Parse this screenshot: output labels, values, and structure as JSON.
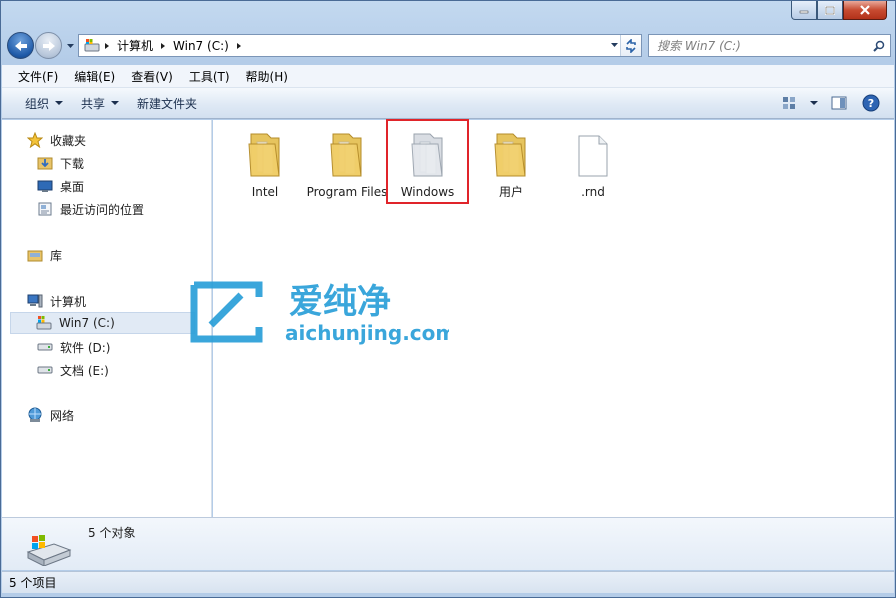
{
  "window": {
    "caption": {
      "minimize": "minimize",
      "maximize": "maximize",
      "close": "close"
    }
  },
  "address": {
    "crumbs": [
      "计算机",
      "Win7 (C:)"
    ]
  },
  "search": {
    "placeholder": "搜索 Win7 (C:)"
  },
  "menu": [
    "文件(F)",
    "编辑(E)",
    "查看(V)",
    "工具(T)",
    "帮助(H)"
  ],
  "toolbar": {
    "organize": "组织",
    "share": "共享",
    "new_folder": "新建文件夹"
  },
  "sidebar": {
    "favorites": {
      "label": "收藏夹",
      "items": [
        "下载",
        "桌面",
        "最近访问的位置"
      ]
    },
    "libraries": {
      "label": "库"
    },
    "computer": {
      "label": "计算机",
      "items": [
        "Win7 (C:)",
        "软件 (D:)",
        "文档 (E:)"
      ]
    },
    "network": {
      "label": "网络"
    }
  },
  "files": [
    {
      "name": "Intel",
      "type": "folder"
    },
    {
      "name": "Program Files",
      "type": "folder"
    },
    {
      "name": "Windows",
      "type": "folder",
      "highlighted": true
    },
    {
      "name": "用户",
      "type": "folder"
    },
    {
      "name": ".rnd",
      "type": "file"
    }
  ],
  "watermark": {
    "brand": "爱纯净",
    "domain": "aichunjing.com"
  },
  "details": {
    "summary": "5 个对象"
  },
  "status": {
    "count": "5 个项目"
  },
  "colors": {
    "accent": "#1f5aa8",
    "highlight_border": "#e0242a",
    "watermark": "#2a9fd8"
  }
}
